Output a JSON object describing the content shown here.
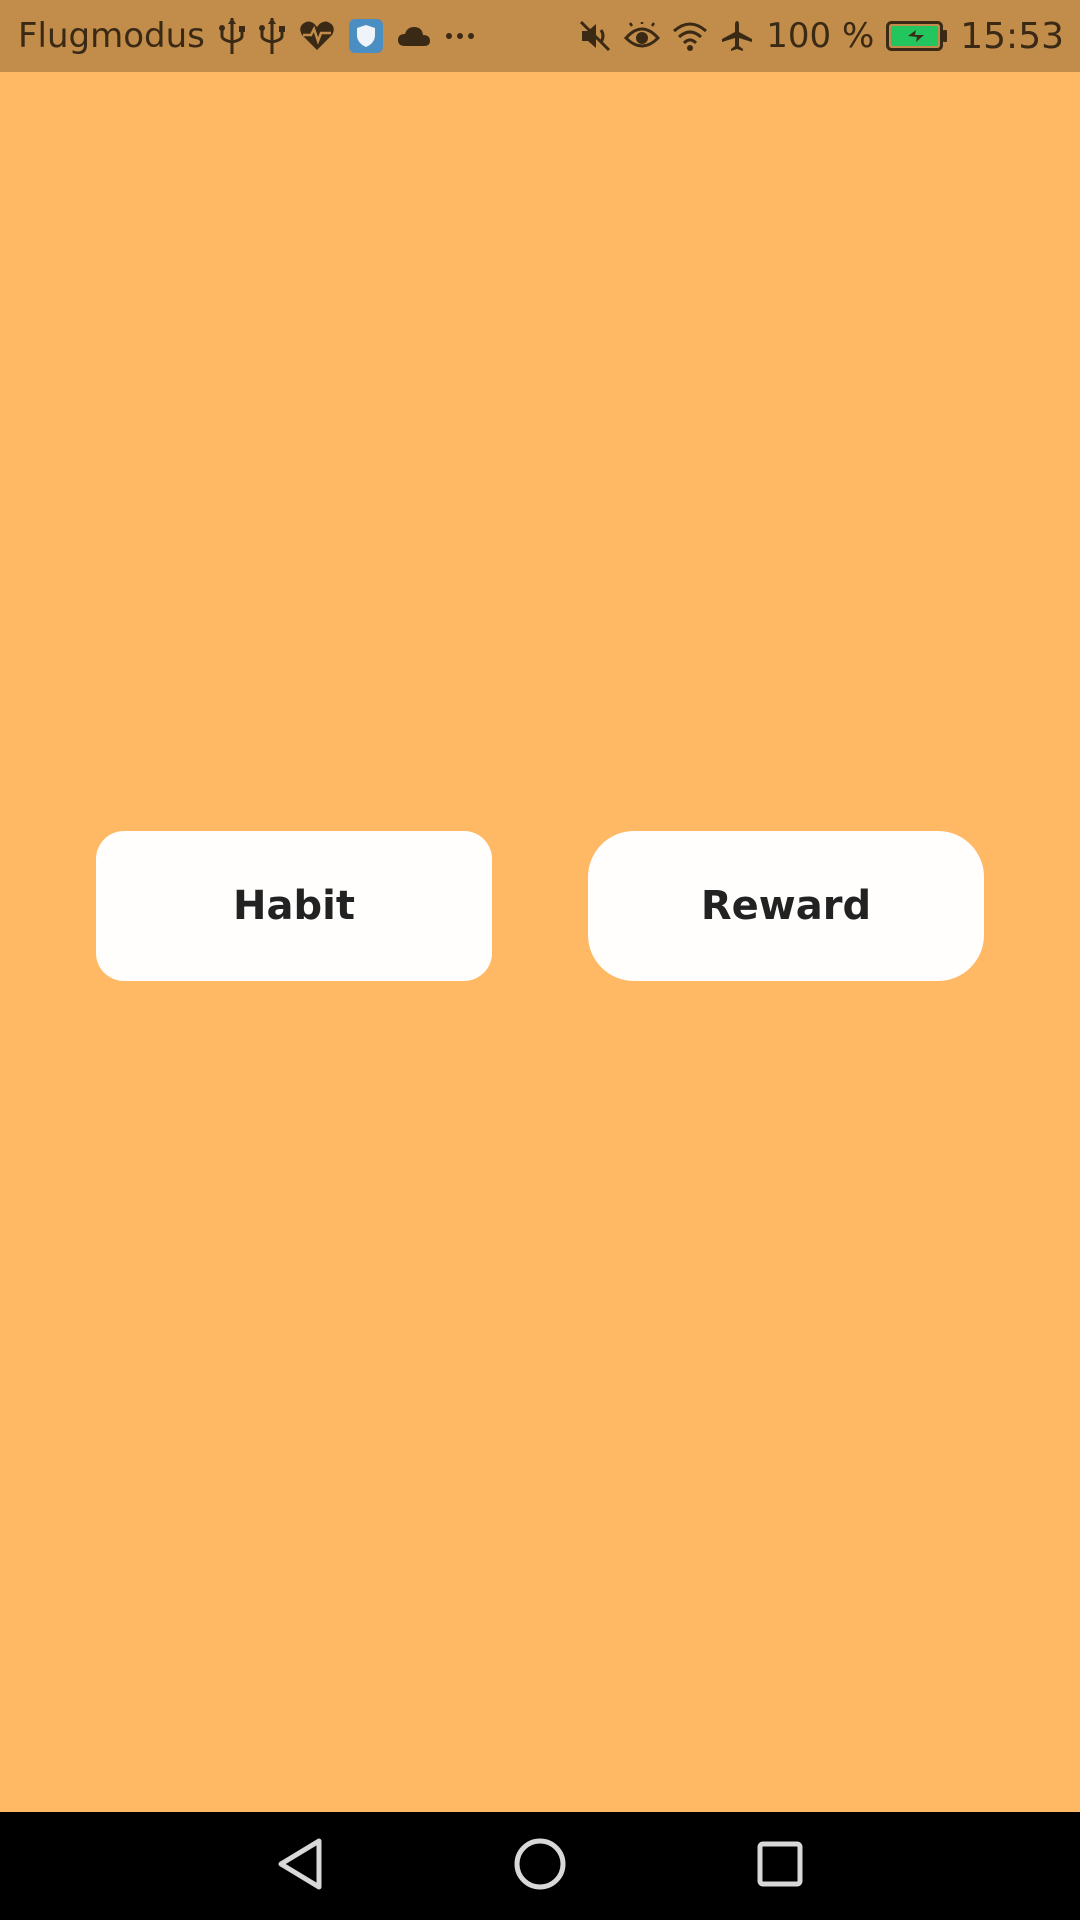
{
  "status_bar": {
    "carrier": "Flugmodus",
    "battery_percent": "100 %",
    "time": "15:53",
    "left_icons": [
      "usb-icon",
      "usb-icon",
      "health-icon",
      "shield-app-icon",
      "cloud-icon",
      "more-icon"
    ],
    "right_icons": [
      "mute-icon",
      "eye-icon",
      "wifi-icon",
      "airplane-icon",
      "battery-charging-icon"
    ],
    "battery_color": "#22c55e"
  },
  "main": {
    "background": "#ffb964",
    "buttons": [
      {
        "label": "Habit"
      },
      {
        "label": "Reward"
      }
    ]
  },
  "nav_bar": {
    "items": [
      "back-icon",
      "home-icon",
      "recents-icon"
    ]
  }
}
